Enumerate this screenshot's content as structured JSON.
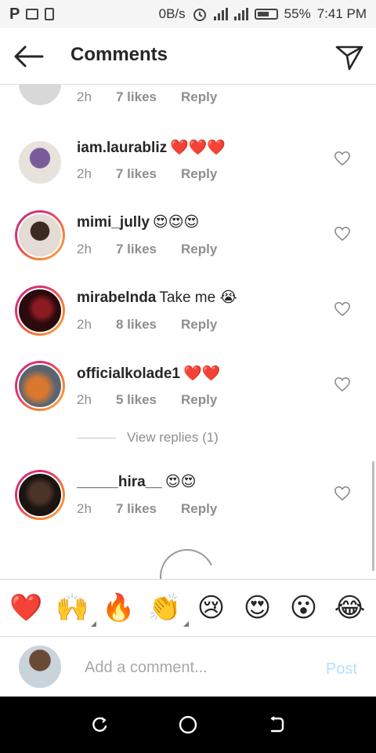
{
  "status_bar": {
    "left_icons": [
      "p-icon",
      "image-icon",
      "battery-save-icon"
    ],
    "data_speed": "0B/s",
    "battery_percent": "55%",
    "time": "7:41 PM"
  },
  "header": {
    "title": "Comments"
  },
  "comments": [
    {
      "username": "",
      "text": "",
      "time": "2h",
      "likes": "7 likes",
      "reply": "Reply",
      "avatar_color": "#d8d8d8"
    },
    {
      "username": "iam.laurabliz",
      "text": "❤️❤️❤️",
      "time": "2h",
      "likes": "7 likes",
      "reply": "Reply",
      "avatar_color": "#7a5b9a"
    },
    {
      "username": "mimi_jully",
      "text": "😍😍😍",
      "time": "2h",
      "likes": "7 likes",
      "reply": "Reply",
      "avatar_color": "#b0a090"
    },
    {
      "username": "mirabelnda",
      "text": "Take me 😭",
      "time": "2h",
      "likes": "8 likes",
      "reply": "Reply",
      "avatar_color": "#5a1218"
    },
    {
      "username": "officialkolade1",
      "text": "❤️❤️",
      "time": "2h",
      "likes": "5 likes",
      "reply": "Reply",
      "avatar_color": "#c86a2a"
    },
    {
      "username": "_____hira__",
      "text": "😍😍",
      "time": "2h",
      "likes": "7 likes",
      "reply": "Reply",
      "avatar_color": "#3a2a22"
    }
  ],
  "view_replies": "View replies (1)",
  "emoji_bar": [
    "❤️",
    "🙌",
    "🔥",
    "👏",
    "😢",
    "😍",
    "😮",
    "😂"
  ],
  "compose": {
    "placeholder": "Add a comment...",
    "post_label": "Post"
  },
  "colors": {
    "ring_start": "#c13584",
    "ring_end": "#fcaf45",
    "meta_gray": "#8e8e8e",
    "post_disabled": "#b2dffc"
  }
}
